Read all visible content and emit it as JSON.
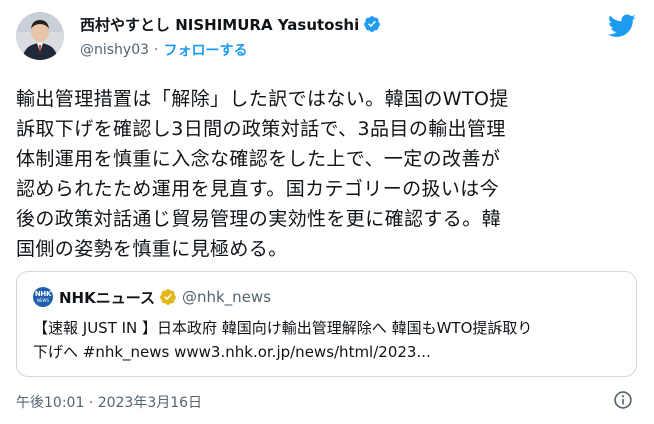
{
  "author": {
    "display_name": "西村やすとし NISHIMURA Yasutoshi",
    "handle": "@nishy03",
    "separator": "·",
    "follow_label": "フォローする",
    "avatar_icon": "person-avatar"
  },
  "tweet": {
    "lines": [
      "輸出管理措置は「解除」した訳ではない。韓国のWTO提",
      "訴取下げを確認し3日間の政策対話で、3品目の輸出管理",
      "体制運用を慎重に入念な確認をした上で、一定の改善が",
      "認められたため運用を見直す。国カテゴリーの扱いは今",
      "後の政策対話通じ貿易管理の実効性を更に確認する。韓",
      "国側の姿勢を慎重に見極める。"
    ],
    "timestamp": "午後10:01 · 2023年3月16日"
  },
  "quote": {
    "logo_top": "NHK",
    "logo_bottom": "NEWS",
    "name": "NHKニュース",
    "handle": "@nhk_news",
    "lines": [
      "【速報 JUST IN 】日本政府 韓国向け輸出管理解除へ 韓国もWTO提訴取り",
      "下げへ #nhk_news www3.nhk.or.jp/news/html/2023..."
    ]
  },
  "colors": {
    "twitter_blue": "#1d9bf0",
    "text": "#0f1419",
    "secondary": "#536471",
    "border": "#cfd9de",
    "verified_blue": "#1d9bf0",
    "verified_gold": "#e2b719"
  }
}
